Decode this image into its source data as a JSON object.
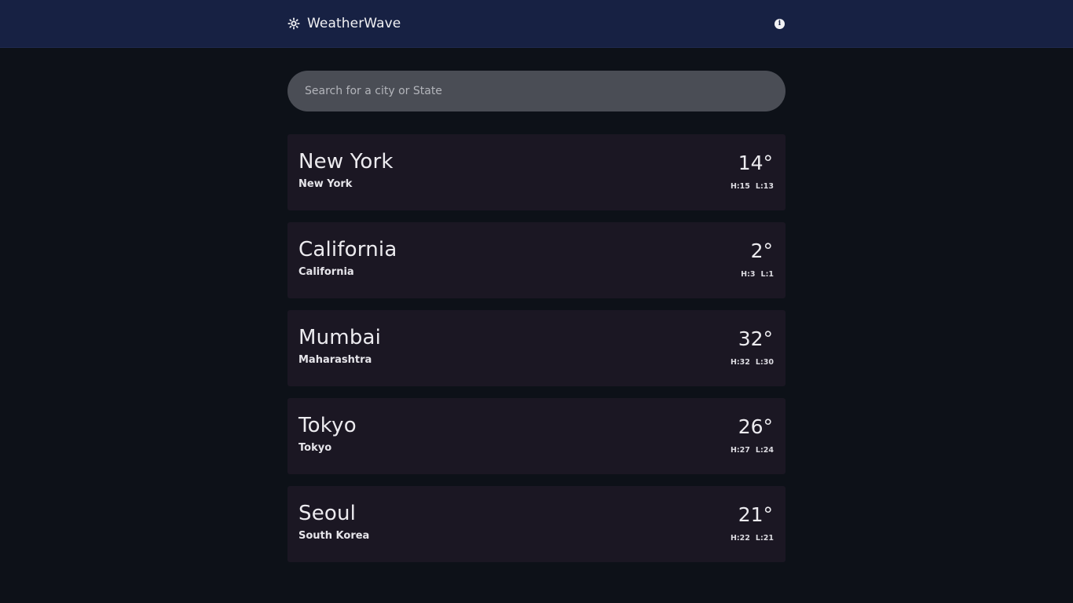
{
  "header": {
    "title": "WeatherWave",
    "logo_icon": "sun-icon",
    "info_icon": "info-icon"
  },
  "search": {
    "placeholder": "Search for a city or State",
    "value": ""
  },
  "cities": [
    {
      "name": "New York",
      "region": "New York",
      "temp": "14°",
      "high": "H:15",
      "low": "L:13"
    },
    {
      "name": "California",
      "region": "California",
      "temp": "2°",
      "high": "H:3",
      "low": "L:1"
    },
    {
      "name": "Mumbai",
      "region": "Maharashtra",
      "temp": "32°",
      "high": "H:32",
      "low": "L:30"
    },
    {
      "name": "Tokyo",
      "region": "Tokyo",
      "temp": "26°",
      "high": "H:27",
      "low": "L:24"
    },
    {
      "name": "Seoul",
      "region": "South Korea",
      "temp": "21°",
      "high": "H:22",
      "low": "L:21"
    }
  ],
  "colors": {
    "header_bg": "#172143",
    "page_bg": "#0d1118",
    "card_bg": "#1b1723",
    "search_bg": "#4a4d55"
  }
}
